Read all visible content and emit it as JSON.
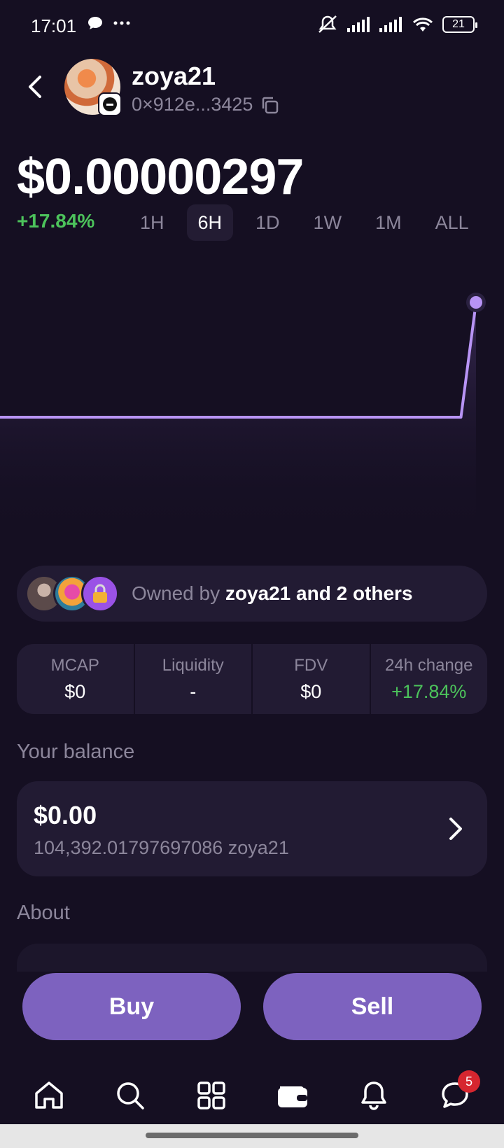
{
  "status_bar": {
    "time": "17:01",
    "battery": "21",
    "icons": [
      "chat-bubble-icon",
      "more-dots-icon",
      "mute-icon",
      "signal-icon",
      "signal-icon",
      "wifi-icon",
      "battery-icon"
    ]
  },
  "header": {
    "token_name": "zoya21",
    "address": "0×912e...3425"
  },
  "price": {
    "value": "$0.00000297",
    "change": "+17.84%"
  },
  "ranges": [
    {
      "label": "1H",
      "active": false
    },
    {
      "label": "6H",
      "active": true
    },
    {
      "label": "1D",
      "active": false
    },
    {
      "label": "1W",
      "active": false
    },
    {
      "label": "1M",
      "active": false
    },
    {
      "label": "ALL",
      "active": false
    }
  ],
  "chart_data": {
    "type": "line",
    "color": "#b894f5",
    "x": [
      0,
      0.92,
      0.95
    ],
    "y": [
      1,
      1,
      2.3
    ]
  },
  "owners": {
    "prefix": "Owned by ",
    "emphasis": "zoya21 and 2 others"
  },
  "stats": [
    {
      "label": "MCAP",
      "value": "$0"
    },
    {
      "label": "Liquidity",
      "value": "-"
    },
    {
      "label": "FDV",
      "value": "$0"
    },
    {
      "label": "24h change",
      "value": "+17.84%"
    }
  ],
  "balance": {
    "section_title": "Your balance",
    "usd": "$0.00",
    "tokens": "104,392.01797697086 zoya21"
  },
  "about": {
    "section_title": "About"
  },
  "actions": {
    "buy": "Buy",
    "sell": "Sell"
  },
  "nav": {
    "items": [
      "home-icon",
      "search-icon",
      "grid-icon",
      "wallet-icon",
      "bell-icon",
      "chat-icon"
    ],
    "chat_badge": "5"
  },
  "colors": {
    "background": "#150f22",
    "accent": "#7d62bf",
    "positive": "#4cc35b",
    "line": "#b894f5"
  }
}
